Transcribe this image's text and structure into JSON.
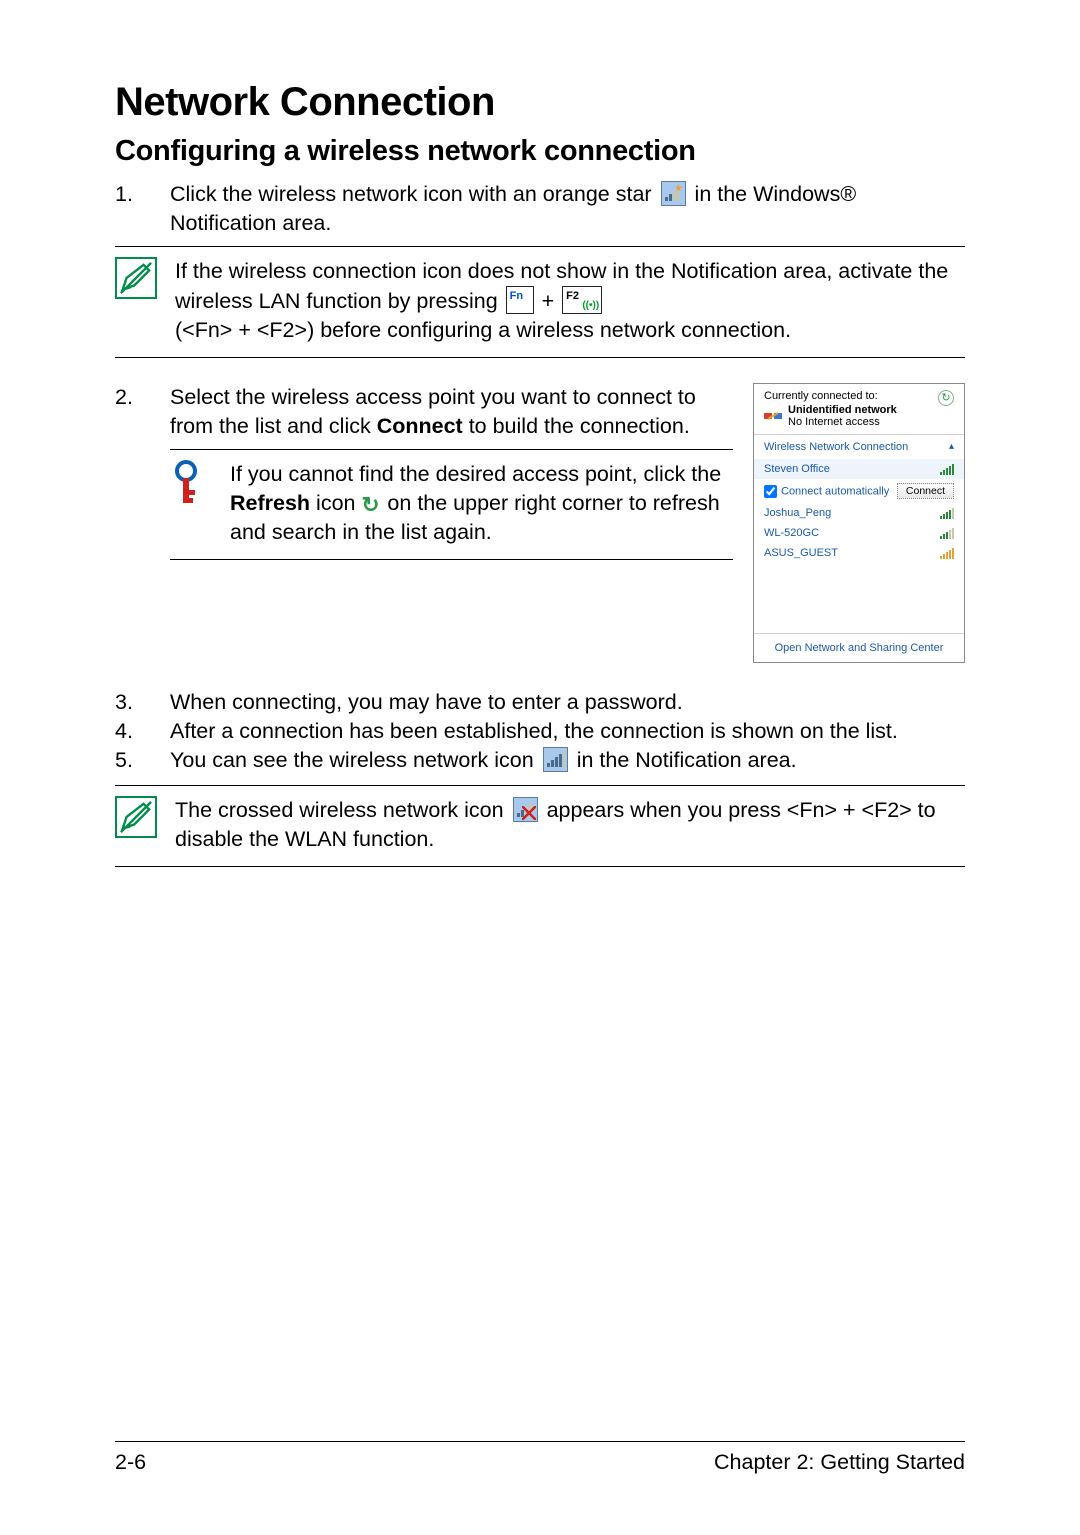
{
  "title": "Network Connection",
  "subtitle": "Configuring a wireless network connection",
  "steps": {
    "s1_a": "Click the wireless network icon with an orange star",
    "s1_b": "in the Windows® Notification area.",
    "note1_a": "If the wireless connection icon does not show in the Notification area, activate the wireless LAN function by pressing",
    "note1_plus": "+",
    "note1_b": "(<Fn> + <F2>) before configuring a wireless network connection.",
    "key_fn": "Fn",
    "key_f2": "F2",
    "s2": "Select the wireless access point you want to connect to from the list and click ",
    "s2_bold": "Connect",
    "s2_after": " to build the connection.",
    "note2_a": "If you cannot find the desired access point, click the ",
    "note2_bold": "Refresh",
    "note2_b": " icon ",
    "note2_c": " on the upper right corner to refresh and search in the list again.",
    "s3": "When connecting, you may have to enter a password.",
    "s4": "After a connection has been established, the connection is shown on the list.",
    "s5_a": "You can see the wireless network icon",
    "s5_b": "in the Notification area.",
    "note3_a": "The crossed wireless network icon",
    "note3_b": "appears when you press <Fn> + <F2> to disable the WLAN function."
  },
  "wifi": {
    "currently": "Currently connected to:",
    "net_name": "Unidentified network",
    "net_status": "No Internet access",
    "section": "Wireless Network Connection",
    "items": [
      "Steven Office",
      "Joshua_Peng",
      "WL-520GC",
      "ASUS_GUEST"
    ],
    "auto": "Connect automatically",
    "connect": "Connect",
    "footer": "Open Network and Sharing Center"
  },
  "footer": {
    "page": "2-6",
    "chapter": "Chapter 2: Getting Started"
  }
}
